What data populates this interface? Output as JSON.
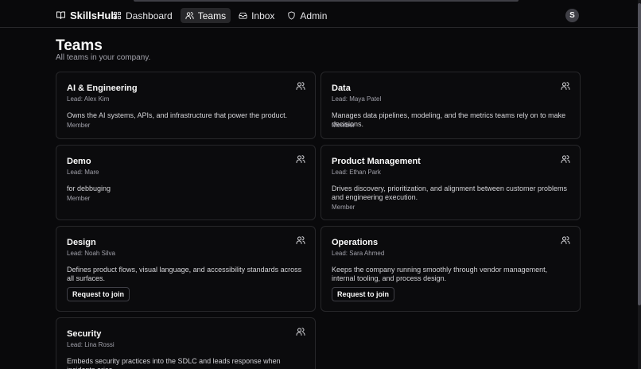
{
  "brand": {
    "name": "SkillsHub",
    "icon": "book-open-icon"
  },
  "nav": [
    {
      "label": "Dashboard",
      "icon": "grid-icon",
      "active": false
    },
    {
      "label": "Teams",
      "icon": "users-icon",
      "active": true
    },
    {
      "label": "Inbox",
      "icon": "inbox-icon",
      "active": false
    },
    {
      "label": "Admin",
      "icon": "shield-icon",
      "active": false
    }
  ],
  "user": {
    "initial": "S"
  },
  "page": {
    "title": "Teams",
    "subtitle": "All teams in your company."
  },
  "teams": [
    {
      "name": "AI & Engineering",
      "lead": "Lead: Alex Kim",
      "description": "Owns the AI systems, APIs, and infrastructure that power the product.",
      "membership": "Member",
      "action": ""
    },
    {
      "name": "Data",
      "lead": "Lead: Maya Patel",
      "description": "Manages data pipelines, modeling, and the metrics teams rely on to make decisions.",
      "membership": "Member",
      "action": ""
    },
    {
      "name": "Demo",
      "lead": "Lead: Mare",
      "description": "for debbuging",
      "membership": "Member",
      "action": ""
    },
    {
      "name": "Product Management",
      "lead": "Lead: Ethan Park",
      "description": "Drives discovery, prioritization, and alignment between customer problems and engineering execution.",
      "membership": "Member",
      "action": ""
    },
    {
      "name": "Design",
      "lead": "Lead: Noah Silva",
      "description": "Defines product flows, visual language, and accessibility standards across all surfaces.",
      "membership": "",
      "action": "Request to join"
    },
    {
      "name": "Operations",
      "lead": "Lead: Sara Ahmed",
      "description": "Keeps the company running smoothly through vendor management, internal tooling, and process design.",
      "membership": "",
      "action": "Request to join"
    },
    {
      "name": "Security",
      "lead": "Lead: Lina Rossi",
      "description": "Embeds security practices into the SDLC and leads response when incidents arise.",
      "membership": "",
      "action": ""
    }
  ],
  "colors": {
    "background": "#09090b",
    "border": "#27272a",
    "muted": "#a1a1aa"
  }
}
